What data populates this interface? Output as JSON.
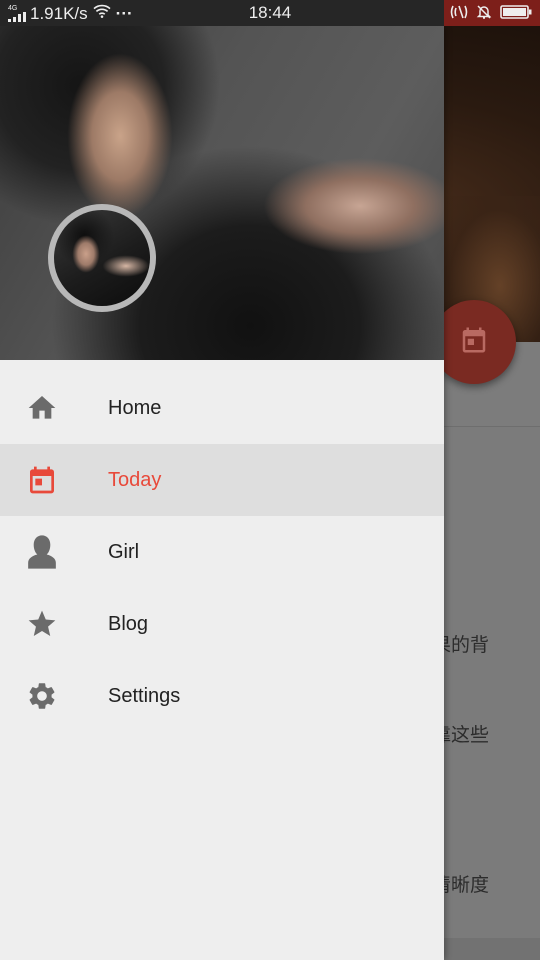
{
  "status_bar": {
    "network_type": "4G",
    "speed": "1.91K/s",
    "more": "···",
    "time": "18:44"
  },
  "drawer": {
    "menu": [
      {
        "label": "Home",
        "icon": "home-icon",
        "active": false
      },
      {
        "label": "Today",
        "icon": "calendar-icon",
        "active": true
      },
      {
        "label": "Girl",
        "icon": "person-icon",
        "active": false
      },
      {
        "label": "Blog",
        "icon": "star-icon",
        "active": false
      },
      {
        "label": "Settings",
        "icon": "gear-icon",
        "active": false
      }
    ]
  },
  "background": {
    "text_lines": [
      "果的背",
      "靠这些",
      "清晰度"
    ]
  },
  "colors": {
    "accent": "#e8493a",
    "icon_gray": "#6b6b6b",
    "drawer_bg": "#eeeeee",
    "active_bg": "#dedede",
    "status_bar_right": "#7d1f1a"
  }
}
